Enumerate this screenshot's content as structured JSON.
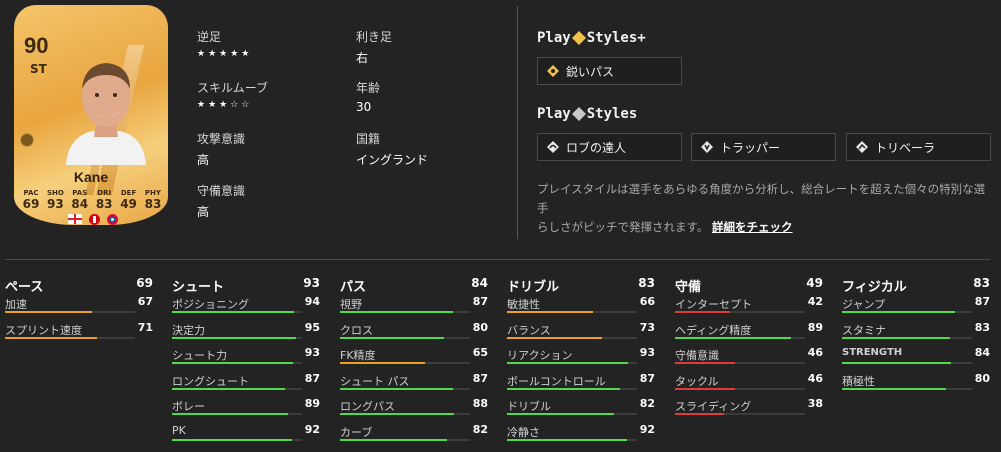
{
  "card": {
    "rating": "90",
    "position": "ST",
    "name": "Kane",
    "stats": [
      {
        "label": "PAC",
        "value": "69"
      },
      {
        "label": "SHO",
        "value": "93"
      },
      {
        "label": "PAS",
        "value": "84"
      },
      {
        "label": "DRI",
        "value": "83"
      },
      {
        "label": "DEF",
        "value": "49"
      },
      {
        "label": "PHY",
        "value": "83"
      }
    ],
    "colors": {
      "gold": "#e9a53f",
      "text": "#3b2a10"
    }
  },
  "info": {
    "weak_foot_label": "逆足",
    "weak_foot_stars": "★★★★★",
    "preferred_foot_label": "利き足",
    "preferred_foot_value": "右",
    "skill_moves_label": "スキルムーブ",
    "skill_moves_stars": "★★★☆☆",
    "age_label": "年齢",
    "age_value": "30",
    "att_wr_label": "攻撃意識",
    "att_wr_value": "高",
    "nation_label": "国籍",
    "nation_value": "イングランド",
    "def_wr_label": "守備意識",
    "def_wr_value": "高"
  },
  "playstyles_plus": {
    "title_pre": "Play",
    "title_post": "Styles+",
    "items": [
      "鋭いパス"
    ]
  },
  "playstyles": {
    "title_pre": "Play",
    "title_post": "Styles",
    "items": [
      "ロブの達人",
      "トラッパー",
      "トリベーラ"
    ]
  },
  "description": {
    "line1": "プレイスタイルは選手をあらゆる角度から分析し、総合レートを超えた個々の特別な選手",
    "line2": "らしさがピッチで発揮されます。",
    "link": "詳細をチェック"
  },
  "stats": [
    {
      "name": "ペース",
      "value": "69",
      "items": [
        {
          "name": "加速",
          "value": 67
        },
        {
          "name": "スプリント速度",
          "value": 71
        }
      ]
    },
    {
      "name": "シュート",
      "value": "93",
      "items": [
        {
          "name": "ポジショニング",
          "value": 94
        },
        {
          "name": "決定力",
          "value": 95
        },
        {
          "name": "シュート力",
          "value": 93
        },
        {
          "name": "ロングシュート",
          "value": 87
        },
        {
          "name": "ボレー",
          "value": 89
        },
        {
          "name": "PK",
          "value": 92
        }
      ]
    },
    {
      "name": "パス",
      "value": "84",
      "items": [
        {
          "name": "視野",
          "value": 87
        },
        {
          "name": "クロス",
          "value": 80
        },
        {
          "name": "FK精度",
          "value": 65
        },
        {
          "name": "シュート パス",
          "value": 87
        },
        {
          "name": "ロングパス",
          "value": 88
        },
        {
          "name": "カーブ",
          "value": 82
        }
      ]
    },
    {
      "name": "ドリブル",
      "value": "83",
      "items": [
        {
          "name": "敏捷性",
          "value": 66
        },
        {
          "name": "バランス",
          "value": 73
        },
        {
          "name": "リアクション",
          "value": 93
        },
        {
          "name": "ボールコントロール",
          "value": 87
        },
        {
          "name": "ドリブル",
          "value": 82
        },
        {
          "name": "冷静さ",
          "value": 92
        }
      ]
    },
    {
      "name": "守備",
      "value": "49",
      "items": [
        {
          "name": "インターセプト",
          "value": 42
        },
        {
          "name": "ヘディング精度",
          "value": 89
        },
        {
          "name": "守備意識",
          "value": 46
        },
        {
          "name": "タックル",
          "value": 46
        },
        {
          "name": "スライディング",
          "value": 38
        }
      ]
    },
    {
      "name": "フィジカル",
      "value": "83",
      "items": [
        {
          "name": "ジャンプ",
          "value": 87
        },
        {
          "name": "スタミナ",
          "value": 83
        },
        {
          "name": "STRENGTH",
          "value": 84
        },
        {
          "name": "積極性",
          "value": 80
        }
      ]
    }
  ],
  "colors": {
    "bar_high": "#4ddb4d",
    "bar_mid": "#f0a020",
    "bar_low": "#e03b3b",
    "gold_diamond": "#f3c14a",
    "silver_diamond": "#c8c8c8"
  }
}
